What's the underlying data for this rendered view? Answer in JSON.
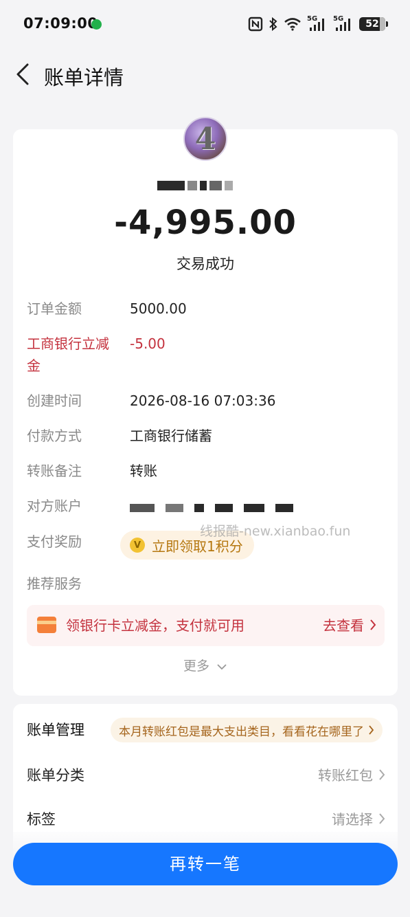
{
  "status_bar": {
    "time": "07:09:00",
    "network_5g_1": "5G",
    "network_5g_2": "5G",
    "battery": "52"
  },
  "nav": {
    "title": "账单详情"
  },
  "transaction": {
    "amount": "-4,995.00",
    "status": "交易成功"
  },
  "details": [
    {
      "label": "订单金额",
      "value": "5000.00"
    },
    {
      "label": "工商银行立减金",
      "value": "-5.00"
    },
    {
      "label": "创建时间",
      "value": "2026-08-16 07:03:36"
    },
    {
      "label": "付款方式",
      "value": "工商银行储蓄"
    },
    {
      "label": "转账备注",
      "value": "转账"
    },
    {
      "label": "对方账户",
      "value": ""
    },
    {
      "label": "支付奖励",
      "value": "立即领取1积分"
    },
    {
      "label": "推荐服务",
      "value": ""
    }
  ],
  "reward": {
    "button_label": "立即领取1积分"
  },
  "watermark": "线报酷-new.xianbao.fun",
  "promo": {
    "text": "领银行卡立减金，支付就可用",
    "link": "去查看"
  },
  "more_label": "更多",
  "management": {
    "title": "账单管理",
    "tip": "本月转账红包是最大支出类目，看看花在哪里了",
    "rows": [
      {
        "label": "账单分类",
        "value": "转账红包"
      },
      {
        "label": "标签",
        "value": "请选择"
      }
    ]
  },
  "cta": {
    "label": "再转一笔"
  },
  "colors": {
    "primary": "#1677ff",
    "discount_red": "#c4323e",
    "reward_gold": "#b5770f"
  }
}
